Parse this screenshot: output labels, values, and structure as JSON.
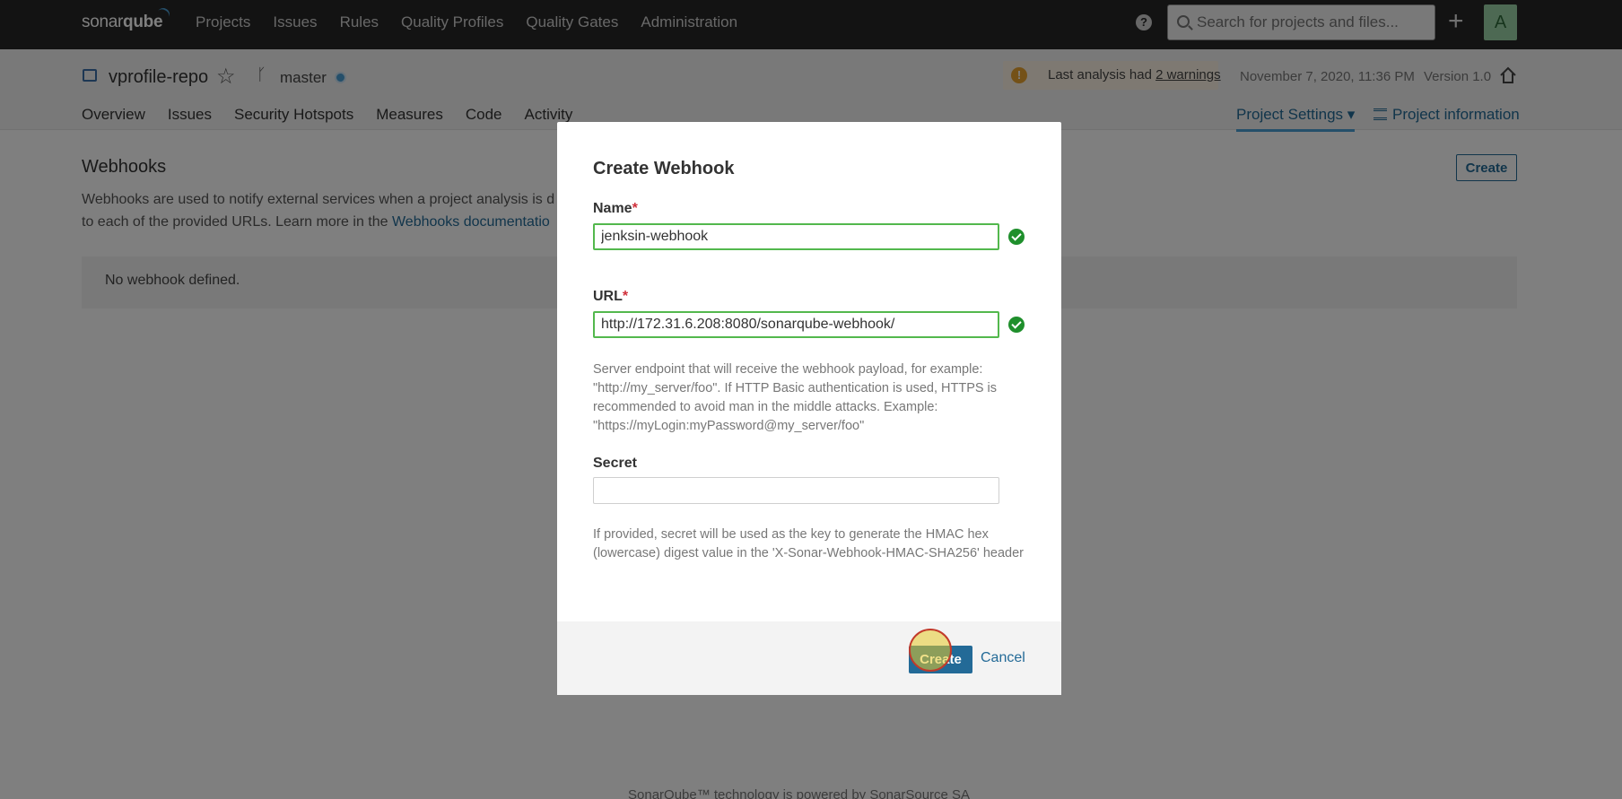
{
  "topnav": {
    "logo_regular": "sonar",
    "logo_bold": "qube",
    "items": [
      {
        "label": "Projects"
      },
      {
        "label": "Issues"
      },
      {
        "label": "Rules"
      },
      {
        "label": "Quality Profiles"
      },
      {
        "label": "Quality Gates"
      },
      {
        "label": "Administration"
      }
    ],
    "help_glyph": "?",
    "search_placeholder": "Search for projects and files...",
    "plus_glyph": "+",
    "avatar_letter": "A"
  },
  "project": {
    "name": "vprofile-repo",
    "branch": "master",
    "warning_prefix": "Last analysis had ",
    "warning_link": "2 warnings",
    "analysis_date": "November 7, 2020, 11:36 PM",
    "version": "Version 1.0",
    "tabs": [
      {
        "label": "Overview"
      },
      {
        "label": "Issues"
      },
      {
        "label": "Security Hotspots"
      },
      {
        "label": "Measures"
      },
      {
        "label": "Code"
      },
      {
        "label": "Activity"
      }
    ],
    "settings_label": "Project Settings ▾",
    "info_label": "Project information"
  },
  "page": {
    "title": "Webhooks",
    "create_label": "Create",
    "desc_line1": "Webhooks are used to notify external services when a project analysis is d",
    "desc_line2_prefix": "to each of the provided URLs. Learn more in the ",
    "desc_link": "Webhooks documentatio",
    "empty_text": "No webhook defined.",
    "footer": "SonarQube™ technology is powered by SonarSource SA"
  },
  "modal": {
    "title": "Create Webhook",
    "name_label": "Name",
    "name_value": "jenksin-webhook",
    "url_label": "URL",
    "url_value": "http://172.31.6.208:8080/sonarqube-webhook/",
    "url_help": "Server endpoint that will receive the webhook payload, for example: \"http://my_server/foo\". If HTTP Basic authentication is used, HTTPS is recommended to avoid man in the middle attacks. Example: \"https://myLogin:myPassword@my_server/foo\"",
    "secret_label": "Secret",
    "secret_value": "",
    "secret_help": "If provided, secret will be used as the key to generate the HMAC hex (lowercase) digest value in the 'X-Sonar-Webhook-HMAC-SHA256' header",
    "required_mark": "*",
    "create_button": "Create",
    "cancel_button": "Cancel"
  },
  "icons": {
    "repo": "repo-icon",
    "star": "star-icon",
    "branch": "branch-icon",
    "warning": "warning-icon",
    "home": "home-icon",
    "check": "check-icon",
    "search": "search-icon"
  },
  "colors": {
    "nav_bg": "#262626",
    "link_blue": "#236a97",
    "valid_green": "#53b84d",
    "required_red": "#d02f3a"
  }
}
